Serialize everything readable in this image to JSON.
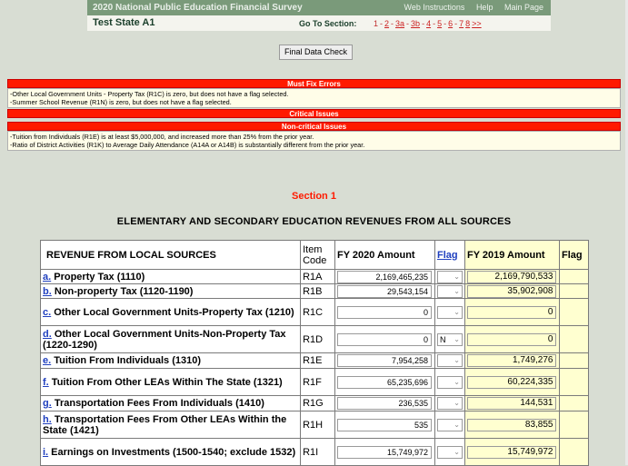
{
  "header": {
    "survey_title": "2020 National Public Education Financial Survey",
    "links": [
      "Web Instructions",
      "Help",
      "Main Page"
    ],
    "state_name": "Test State A1",
    "goto_label": "Go To Section:",
    "sections": [
      {
        "label": "1",
        "current": true
      },
      {
        "label": "2"
      },
      {
        "label": "3a"
      },
      {
        "label": "3b"
      },
      {
        "label": "4"
      },
      {
        "label": "5"
      },
      {
        "label": "6"
      },
      {
        "label": "7"
      },
      {
        "label": "8"
      },
      {
        "label": ">>"
      }
    ]
  },
  "final_check_label": "Final Data Check",
  "must_fix": {
    "title": "Must Fix Errors",
    "items": [
      "-Other Local Government Units - Property Tax (R1C) is zero, but does not have a flag selected.",
      "-Summer School Revenue (R1N) is zero, but does not have a flag selected."
    ]
  },
  "critical": {
    "title": "Critical Issues"
  },
  "noncritical": {
    "title": "Non-critical Issues",
    "items": [
      "-Tuition from Individuals (R1E) is at least $5,000,000, and increased more than 25% from the prior year.",
      "-Ratio of District Activities (R1K) to Average Daily Attendance (A14A or A14B) is substantially different from the prior year."
    ]
  },
  "section_title": "Section 1",
  "main_title": "ELEMENTARY AND SECONDARY EDUCATION REVENUES FROM ALL SOURCES",
  "table": {
    "headers": {
      "desc": "REVENUE FROM LOCAL SOURCES",
      "code": "Item Code",
      "amount": "FY 2020 Amount",
      "flag": "Flag",
      "prior": "FY 2019 Amount",
      "prior_flag": "Flag"
    },
    "rows": [
      {
        "letter": "a.",
        "desc": " Property Tax (1110)",
        "code": "R1A",
        "amount": "2,169,465,235",
        "flag": "",
        "prior": "2,169,790,533"
      },
      {
        "letter": "b.",
        "desc": " Non-property Tax (1120-1190)",
        "code": "R1B",
        "amount": "29,543,154",
        "flag": "",
        "prior": "35,902,908"
      },
      {
        "letter": "c.",
        "desc": " Other Local Government Units-Property Tax (1210)",
        "code": "R1C",
        "amount": "0",
        "flag": "",
        "prior": "0"
      },
      {
        "letter": "d.",
        "desc": " Other Local Government Units-Non-Property Tax (1220-1290)",
        "code": "R1D",
        "amount": "0",
        "flag": "N",
        "prior": "0"
      },
      {
        "letter": "e.",
        "desc": " Tuition From Individuals (1310)",
        "code": "R1E",
        "amount": "7,954,258",
        "flag": "",
        "prior": "1,749,276"
      },
      {
        "letter": "f.",
        "desc": " Tuition From Other LEAs Within The State (1321)",
        "code": "R1F",
        "amount": "65,235,696",
        "flag": "",
        "prior": "60,224,335"
      },
      {
        "letter": "g.",
        "desc": " Transportation Fees From Individuals (1410)",
        "code": "R1G",
        "amount": "236,535",
        "flag": "",
        "prior": "144,531"
      },
      {
        "letter": "h.",
        "desc": " Transportation Fees From Other LEAs Within the State (1421)",
        "code": "R1H",
        "amount": "535",
        "flag": "",
        "prior": "83,855"
      },
      {
        "letter": "i.",
        "desc": " Earnings on Investments (1500-1540; exclude 1532)",
        "code": "R1I",
        "amount": "15,749,972",
        "flag": "",
        "prior": "15,749,972"
      }
    ]
  },
  "colors": {
    "header_green": "#7a9a7a",
    "error_red": "#ff1a00",
    "prior_yellow": "#ffffd0",
    "link_blue": "#1f3fbf"
  }
}
